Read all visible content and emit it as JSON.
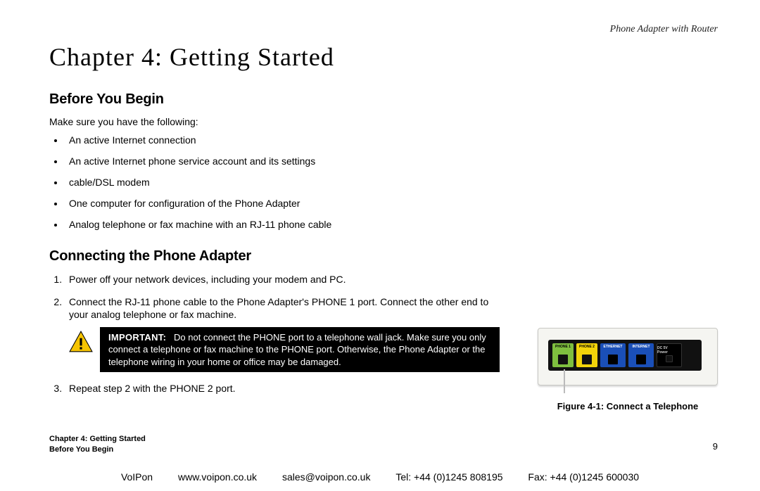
{
  "header": {
    "product": "Phone Adapter with Router"
  },
  "chapter": {
    "title": "Chapter 4: Getting Started"
  },
  "sections": {
    "before": {
      "heading": "Before You Begin",
      "intro": "Make sure you have the following:",
      "bullets": [
        "An active Internet connection",
        "An active Internet phone service account and its settings",
        "cable/DSL modem",
        "One computer for configuration of the Phone Adapter",
        "Analog telephone or fax machine with an RJ-11 phone cable"
      ]
    },
    "connecting": {
      "heading": "Connecting the Phone Adapter",
      "steps": [
        "Power off your network devices, including your modem and PC.",
        "Connect the RJ-11 phone cable to the Phone Adapter's PHONE 1 port. Connect the other end to your analog telephone or fax machine.",
        "Repeat step 2 with the PHONE 2 port."
      ],
      "important_label": "IMPORTANT:",
      "important_text": "Do not connect the PHONE port to a telephone wall jack. Make sure you only connect a telephone or fax machine to the PHONE port. Otherwise, the Phone Adapter or the telephone wiring in your home or office may be damaged."
    }
  },
  "figure": {
    "caption": "Figure 4-1: Connect a Telephone",
    "ports": {
      "phone1": "PHONE 1",
      "phone2": "PHONE 2",
      "ethernet": "ETHERNET",
      "internet": "INTERNET",
      "power": "DC 5V Power"
    }
  },
  "footer_meta": {
    "line1": "Chapter 4: Getting Started",
    "line2": "Before You Begin"
  },
  "page_number": "9",
  "footer_bar": {
    "company": "VoIPon",
    "url": "www.voipon.co.uk",
    "email": "sales@voipon.co.uk",
    "tel": "Tel: +44 (0)1245 808195",
    "fax": "Fax: +44 (0)1245 600030"
  }
}
